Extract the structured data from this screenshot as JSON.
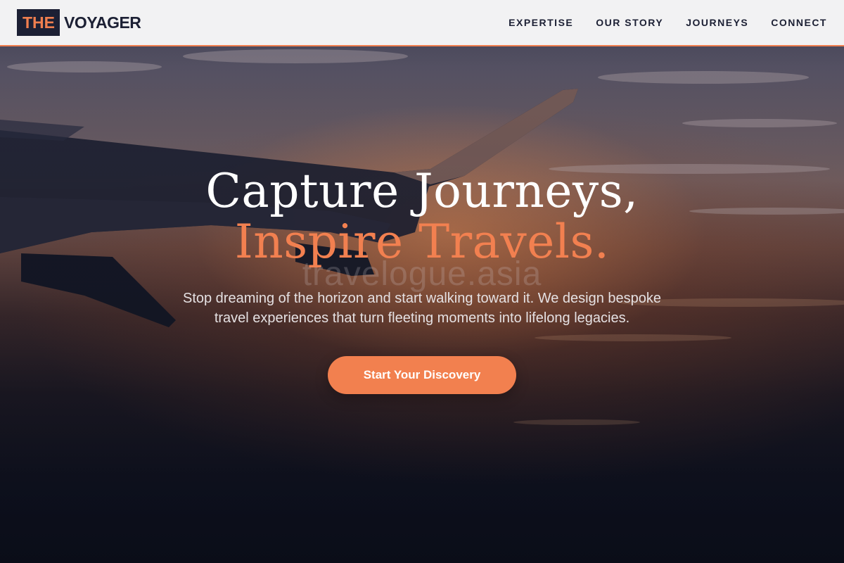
{
  "brand": {
    "mark": "THE",
    "name": "VOYAGER",
    "accent_color": "#f07f4f",
    "dark_color": "#1c2034"
  },
  "nav": {
    "items": [
      {
        "label": "EXPERTISE"
      },
      {
        "label": "OUR STORY"
      },
      {
        "label": "JOURNEYS"
      },
      {
        "label": "CONNECT"
      }
    ]
  },
  "hero": {
    "title_line1": "Capture Journeys,",
    "title_line2": "Inspire Travels.",
    "watermark": "travelogue.asia",
    "subtitle": "Stop dreaming of the horizon and start walking toward it. We design bespoke travel experiences that turn fleeting moments into lifelong legacies.",
    "cta_label": "Start Your Discovery",
    "background": "airplane-wing-sunset-image"
  }
}
